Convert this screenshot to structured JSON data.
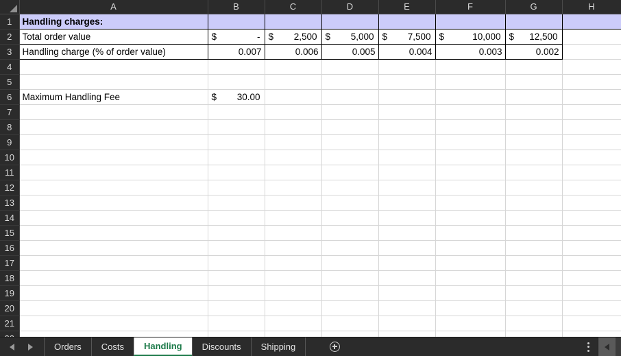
{
  "app": {
    "type": "spreadsheet",
    "active_sheet": "Handling"
  },
  "colors": {
    "band_fill": "#CCCCFA",
    "header_bg": "#2B2B2B",
    "header_text": "#D8D8D8",
    "active_tab_text": "#1C7A49",
    "gridline": "#D6D6D6",
    "cell_border": "#000000"
  },
  "grid": {
    "column_headers": [
      "A",
      "B",
      "C",
      "D",
      "E",
      "F",
      "G",
      "H"
    ],
    "row_headers": [
      "1",
      "2",
      "3",
      "4",
      "5",
      "6",
      "7",
      "8",
      "9",
      "10",
      "11",
      "12",
      "13",
      "14",
      "15",
      "16",
      "17",
      "18",
      "19",
      "20",
      "21",
      "22"
    ],
    "select_all_icon": "select-all-triangle-icon"
  },
  "cells": {
    "a1": "Handling charges:",
    "a2": "Total order value",
    "a3": "Handling charge (% of order value)",
    "a6": "Maximum Handling Fee",
    "order_value": {
      "b": {
        "currency": "$",
        "amount": "-"
      },
      "c": {
        "currency": "$",
        "amount": "2,500"
      },
      "d": {
        "currency": "$",
        "amount": "5,000"
      },
      "e": {
        "currency": "$",
        "amount": "7,500"
      },
      "f": {
        "currency": "$",
        "amount": "10,000"
      },
      "g": {
        "currency": "$",
        "amount": "12,500"
      }
    },
    "handling_rate": {
      "b": "0.007",
      "c": "0.006",
      "d": "0.005",
      "e": "0.004",
      "f": "0.003",
      "g": "0.002"
    },
    "max_fee": {
      "currency": "$",
      "amount": "30.00"
    }
  },
  "chart_data": {
    "type": "table",
    "title": "Handling charges:",
    "row_labels": [
      "Total order value",
      "Handling charge (% of order value)"
    ],
    "columns": [
      "B",
      "C",
      "D",
      "E",
      "F",
      "G"
    ],
    "series": [
      {
        "name": "Total order value",
        "values": [
          0,
          2500,
          5000,
          7500,
          10000,
          12500
        ]
      },
      {
        "name": "Handling charge (% of order value)",
        "values": [
          0.007,
          0.006,
          0.005,
          0.004,
          0.003,
          0.002
        ]
      }
    ],
    "extras": [
      {
        "label": "Maximum Handling Fee",
        "value": 30.0
      }
    ]
  },
  "tabbar": {
    "prev_sheet_icon": "chevron-left-icon",
    "next_sheet_icon": "chevron-right-icon",
    "add_sheet_icon": "plus-circle-icon",
    "options_icon": "more-vertical-icon",
    "scroll_left_icon": "scroll-left-arrow-icon",
    "tabs": [
      {
        "label": "Orders",
        "active": false
      },
      {
        "label": "Costs",
        "active": false
      },
      {
        "label": "Handling",
        "active": true
      },
      {
        "label": "Discounts",
        "active": false
      },
      {
        "label": "Shipping",
        "active": false
      }
    ]
  }
}
